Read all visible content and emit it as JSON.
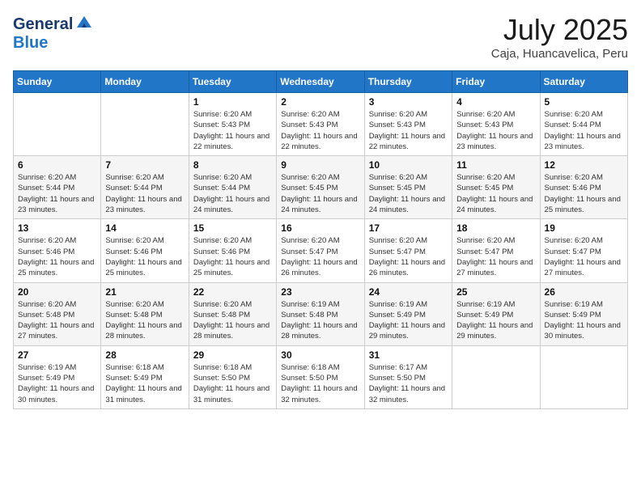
{
  "header": {
    "logo_general": "General",
    "logo_blue": "Blue",
    "month": "July 2025",
    "location": "Caja, Huancavelica, Peru"
  },
  "days_of_week": [
    "Sunday",
    "Monday",
    "Tuesday",
    "Wednesday",
    "Thursday",
    "Friday",
    "Saturday"
  ],
  "weeks": [
    [
      {
        "day": "",
        "info": ""
      },
      {
        "day": "",
        "info": ""
      },
      {
        "day": "1",
        "info": "Sunrise: 6:20 AM\nSunset: 5:43 PM\nDaylight: 11 hours and 22 minutes."
      },
      {
        "day": "2",
        "info": "Sunrise: 6:20 AM\nSunset: 5:43 PM\nDaylight: 11 hours and 22 minutes."
      },
      {
        "day": "3",
        "info": "Sunrise: 6:20 AM\nSunset: 5:43 PM\nDaylight: 11 hours and 22 minutes."
      },
      {
        "day": "4",
        "info": "Sunrise: 6:20 AM\nSunset: 5:43 PM\nDaylight: 11 hours and 23 minutes."
      },
      {
        "day": "5",
        "info": "Sunrise: 6:20 AM\nSunset: 5:44 PM\nDaylight: 11 hours and 23 minutes."
      }
    ],
    [
      {
        "day": "6",
        "info": "Sunrise: 6:20 AM\nSunset: 5:44 PM\nDaylight: 11 hours and 23 minutes."
      },
      {
        "day": "7",
        "info": "Sunrise: 6:20 AM\nSunset: 5:44 PM\nDaylight: 11 hours and 23 minutes."
      },
      {
        "day": "8",
        "info": "Sunrise: 6:20 AM\nSunset: 5:44 PM\nDaylight: 11 hours and 24 minutes."
      },
      {
        "day": "9",
        "info": "Sunrise: 6:20 AM\nSunset: 5:45 PM\nDaylight: 11 hours and 24 minutes."
      },
      {
        "day": "10",
        "info": "Sunrise: 6:20 AM\nSunset: 5:45 PM\nDaylight: 11 hours and 24 minutes."
      },
      {
        "day": "11",
        "info": "Sunrise: 6:20 AM\nSunset: 5:45 PM\nDaylight: 11 hours and 24 minutes."
      },
      {
        "day": "12",
        "info": "Sunrise: 6:20 AM\nSunset: 5:46 PM\nDaylight: 11 hours and 25 minutes."
      }
    ],
    [
      {
        "day": "13",
        "info": "Sunrise: 6:20 AM\nSunset: 5:46 PM\nDaylight: 11 hours and 25 minutes."
      },
      {
        "day": "14",
        "info": "Sunrise: 6:20 AM\nSunset: 5:46 PM\nDaylight: 11 hours and 25 minutes."
      },
      {
        "day": "15",
        "info": "Sunrise: 6:20 AM\nSunset: 5:46 PM\nDaylight: 11 hours and 25 minutes."
      },
      {
        "day": "16",
        "info": "Sunrise: 6:20 AM\nSunset: 5:47 PM\nDaylight: 11 hours and 26 minutes."
      },
      {
        "day": "17",
        "info": "Sunrise: 6:20 AM\nSunset: 5:47 PM\nDaylight: 11 hours and 26 minutes."
      },
      {
        "day": "18",
        "info": "Sunrise: 6:20 AM\nSunset: 5:47 PM\nDaylight: 11 hours and 27 minutes."
      },
      {
        "day": "19",
        "info": "Sunrise: 6:20 AM\nSunset: 5:47 PM\nDaylight: 11 hours and 27 minutes."
      }
    ],
    [
      {
        "day": "20",
        "info": "Sunrise: 6:20 AM\nSunset: 5:48 PM\nDaylight: 11 hours and 27 minutes."
      },
      {
        "day": "21",
        "info": "Sunrise: 6:20 AM\nSunset: 5:48 PM\nDaylight: 11 hours and 28 minutes."
      },
      {
        "day": "22",
        "info": "Sunrise: 6:20 AM\nSunset: 5:48 PM\nDaylight: 11 hours and 28 minutes."
      },
      {
        "day": "23",
        "info": "Sunrise: 6:19 AM\nSunset: 5:48 PM\nDaylight: 11 hours and 28 minutes."
      },
      {
        "day": "24",
        "info": "Sunrise: 6:19 AM\nSunset: 5:49 PM\nDaylight: 11 hours and 29 minutes."
      },
      {
        "day": "25",
        "info": "Sunrise: 6:19 AM\nSunset: 5:49 PM\nDaylight: 11 hours and 29 minutes."
      },
      {
        "day": "26",
        "info": "Sunrise: 6:19 AM\nSunset: 5:49 PM\nDaylight: 11 hours and 30 minutes."
      }
    ],
    [
      {
        "day": "27",
        "info": "Sunrise: 6:19 AM\nSunset: 5:49 PM\nDaylight: 11 hours and 30 minutes."
      },
      {
        "day": "28",
        "info": "Sunrise: 6:18 AM\nSunset: 5:49 PM\nDaylight: 11 hours and 31 minutes."
      },
      {
        "day": "29",
        "info": "Sunrise: 6:18 AM\nSunset: 5:50 PM\nDaylight: 11 hours and 31 minutes."
      },
      {
        "day": "30",
        "info": "Sunrise: 6:18 AM\nSunset: 5:50 PM\nDaylight: 11 hours and 32 minutes."
      },
      {
        "day": "31",
        "info": "Sunrise: 6:17 AM\nSunset: 5:50 PM\nDaylight: 11 hours and 32 minutes."
      },
      {
        "day": "",
        "info": ""
      },
      {
        "day": "",
        "info": ""
      }
    ]
  ]
}
